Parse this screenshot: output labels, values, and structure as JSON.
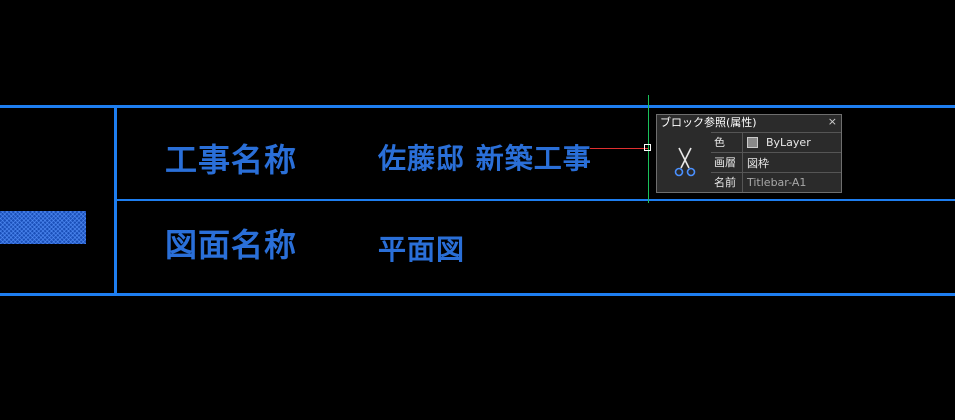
{
  "drawing": {
    "row1": {
      "label": "工事名称",
      "value": "佐藤邸 新築工事"
    },
    "row2": {
      "label": "図面名称",
      "value": "平面図"
    }
  },
  "tooltip": {
    "title": "ブロック参照(属性)",
    "close_label": "×",
    "icon": "scissors-icon",
    "rows": [
      {
        "key": "色",
        "value": "ByLayer",
        "swatch_color": "#8a8a8a"
      },
      {
        "key": "画層",
        "value": "図枠"
      },
      {
        "key": "名前",
        "value": "Titlebar-A1"
      }
    ]
  },
  "colors": {
    "background": "#000000",
    "line": "#1e7ef0",
    "text": "#2a6fd8",
    "crosshair_vertical": "#19c05a",
    "crosshair_horizontal": "#e03030"
  }
}
